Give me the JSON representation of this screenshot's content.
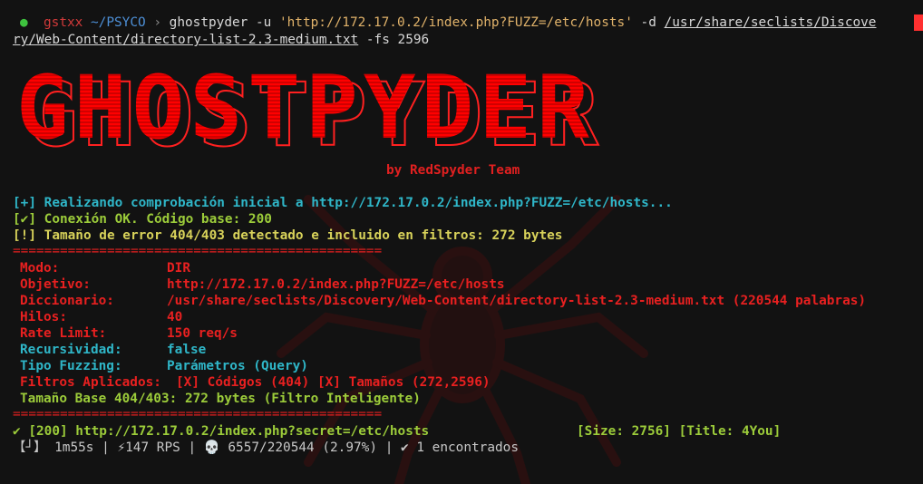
{
  "prompt": {
    "user": "gstxx",
    "path": "~/PSYCO",
    "chevron": "›",
    "command": "ghostpyder",
    "flag_u": "-u",
    "url_arg": "'http://172.17.0.2/index.php?FUZZ=/etc/hosts'",
    "flag_d": "-d",
    "wordlist_part1": "/usr/share/seclists/Discove",
    "wordlist_part2": "ry/Web-Content/directory-list-2.3-medium.txt",
    "flag_fs": "-fs 2596"
  },
  "banner": {
    "title": "GHOSTPYDER",
    "credit": "by RedSpyder Team"
  },
  "checks": [
    "[+] Realizando comprobación inicial a http://172.17.0.2/index.php?FUZZ=/etc/hosts...",
    "[✔] Conexión OK. Código base: 200",
    "[!] Tamaño de error 404/403 detectado e incluido en filtros: 272 bytes"
  ],
  "separator": "===============================================",
  "config": {
    "modo_label": "Modo:",
    "modo_value": "DIR",
    "objetivo_label": "Objetivo:",
    "objetivo_value": "http://172.17.0.2/index.php?FUZZ=/etc/hosts",
    "diccionario_label": "Diccionario:",
    "diccionario_value": "/usr/share/seclists/Discovery/Web-Content/directory-list-2.3-medium.txt (220544 palabras)",
    "hilos_label": "Hilos:",
    "hilos_value": "40",
    "rate_label": "Rate Limit:",
    "rate_value": "150 req/s",
    "recursividad_label": "Recursividad:",
    "recursividad_value": "false",
    "tipo_label": "Tipo Fuzzing:",
    "tipo_value": "Parámetros (Query)",
    "filtros_label": "Filtros Aplicados:",
    "filtros_value": "[X] Códigos (404) [X] Tamaños (272,2596)",
    "tamano_base": "Tamaño Base 404/403: 272 bytes (Filtro Inteligente)"
  },
  "result": {
    "line": "✔ [200] http://172.17.0.2/index.php?secret=/etc/hosts",
    "meta": "[Size: 2756] [Title: 4You]"
  },
  "status": {
    "spinner": "【┘】",
    "elapsed": "1m55s",
    "rps": "⚡147 RPS",
    "progress_icon": "💀",
    "progress": "6557/220544 (2.97%)",
    "found": "✔ 1 encontrados",
    "divider": "|"
  },
  "colors": {
    "background": "#121212",
    "banner_red": "#ff0000",
    "label_red": "#e82020",
    "info_cyan": "#2fb6c8",
    "ok_green": "#9ccc3a"
  }
}
